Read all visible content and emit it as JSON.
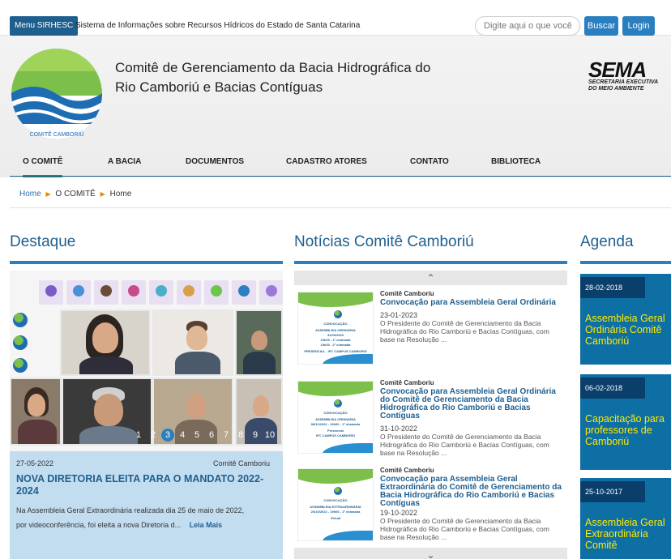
{
  "topbar": {
    "menu_label": "Menu SIRHESC",
    "system_title": "Sistema de Informações sobre Recursos Hídricos do Estado de Santa Catarina",
    "search_placeholder": "Digite aqui o que você pr",
    "search_button": "Buscar",
    "login_button": "Login"
  },
  "header": {
    "org_title_line1": "Comitê de Gerenciamento da Bacia Hidrográfica do",
    "org_title_line2": "Rio Camboriú e Bacias Contíguas",
    "logo_text": "COMITÊ CAMBORIÚ",
    "sema_logo": "SEMA",
    "sema_sub1": "SECRETARIA EXECUTIVA",
    "sema_sub2": "DO MEIO AMBIENTE"
  },
  "nav": {
    "items": [
      "O COMITÊ",
      "A BACIA",
      "DOCUMENTOS",
      "CADASTRO ATORES",
      "CONTATO",
      "BIBLIOTECA"
    ],
    "active": "O COMITÊ"
  },
  "breadcrumb": {
    "items": [
      "Home",
      "O COMITÊ",
      "Home"
    ]
  },
  "destaque": {
    "section_title": "Destaque",
    "pager": [
      "1",
      "2",
      "3",
      "4",
      "5",
      "6",
      "7",
      "8",
      "9",
      "10"
    ],
    "active_page": "3",
    "date": "27-05-2022",
    "source": "Comitê Camboriu",
    "title": "NOVA DIRETORIA ELEITA PARA O MANDATO 2022-2024",
    "text": "Na Assembleia Geral Extraordinária realizada dia 25 de maio de 2022, por videoconferência, foi eleita a nova Diretoria d...",
    "read_more": "Leia Mais"
  },
  "noticias": {
    "section_title": "Notícias Comitê Camboriú",
    "items": [
      {
        "source": "Comitê Camboriu",
        "title": "Convocação para Assembleia Geral Ordinária",
        "date": "23-01-2023",
        "text": "O Presidente do Comitê de Gerenciamento da Bacia Hidrográfica do Rio Camboriú e Bacias Contíguas, com base na Resolução ...",
        "thumb_lines": [
          "CONVOCAÇÃO",
          "ASSEMBLEIA ORDINÁRIA",
          "31/03/2023",
          "19h00 - 1ª chamada",
          "19h30 - 2ª chamada",
          "PRESENCIAL - IFC CAMPUS CAMBORIÚ"
        ]
      },
      {
        "source": "Comitê Camboriu",
        "title": "Convocação para Assembleia Geral Ordinária do Comitê de Gerenciamento da Bacia Hidrográfica do Rio Camboriú e Bacias Contíguas",
        "date": "31-10-2022",
        "text": "O Presidente do Comitê de Gerenciamento da Bacia Hidrográfica do Rio Camboriú e Bacias Contíguas, com base na Resolução ...",
        "thumb_lines": [
          "CONVOCAÇÃO",
          "ASSEMBLEIA ORDINÁRIA",
          "08/11/2022 - 19h00 - 1ª chamada",
          "Presencial",
          "IFC CAMPUS CAMBORIÚ"
        ]
      },
      {
        "source": "Comitê Camboriu",
        "title": "Convocação para Assembleia Geral Extraordinária do Comitê de Gerenciamento da Bacia Hidrográfica do Rio Camboriú e Bacias Contíguas",
        "date": "19-10-2022",
        "text": "O Presidente do Comitê de Gerenciamento da Bacia Hidrográfica do Rio Camboriú e Bacias Contíguas, com base na Resolução ...",
        "thumb_lines": [
          "CONVOCAÇÃO",
          "ASSEMBLEIA EXTRAORDINÁRIA",
          "26/10/2022 - 19h00 - 1ª chamada",
          "Virtual"
        ]
      }
    ]
  },
  "agenda": {
    "section_title": "Agenda",
    "items": [
      {
        "date": "28-02-2018",
        "title": "Assembleia Geral Ordinária Comitê Camboriú"
      },
      {
        "date": "06-02-2018",
        "title": "Capacitação para professores de Camboriú"
      },
      {
        "date": "25-10-2017",
        "title": "Assembleia Geral Extraordinária Comitê"
      }
    ]
  },
  "colors": {
    "primary": "#1f5f8e",
    "button": "#2a7fc0",
    "highlight_bg": "#c3ddf0",
    "agenda_bg": "#0d6fa3",
    "agenda_date_bg": "#0a3f6b",
    "agenda_title": "#ffea00",
    "nav_active": "#2e8b57"
  }
}
